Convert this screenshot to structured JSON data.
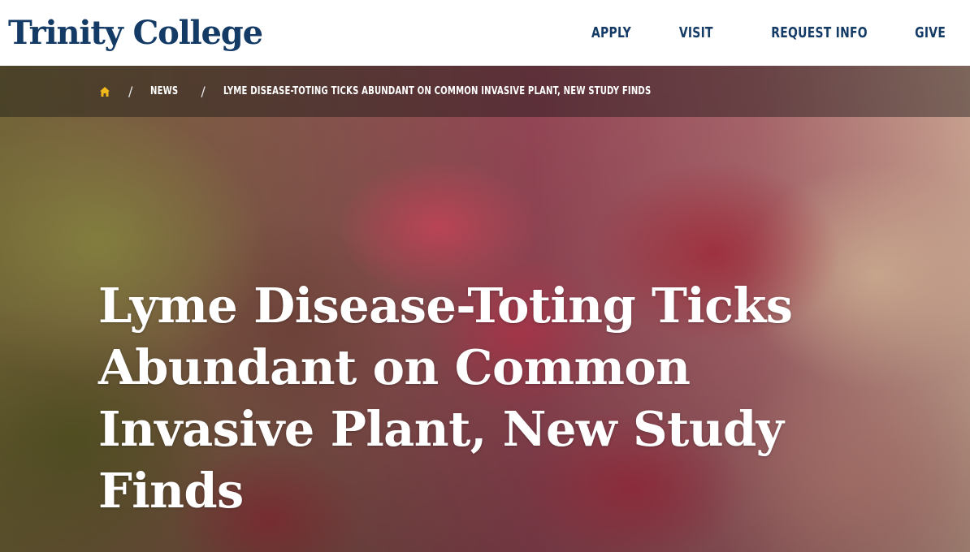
{
  "header": {
    "logo_text": "Trinity College",
    "nav": [
      {
        "label": "APPLY"
      },
      {
        "label": "VISIT"
      },
      {
        "label": "REQUEST INFO"
      },
      {
        "label": "GIVE"
      }
    ]
  },
  "breadcrumb": {
    "home_icon": "home-icon",
    "home_icon_color": "#f2b91c",
    "separator": "/",
    "items": [
      {
        "label": "NEWS"
      },
      {
        "label": "LYME DISEASE-TOTING TICKS ABUNDANT ON COMMON INVASIVE PLANT, NEW STUDY FINDS"
      }
    ]
  },
  "hero": {
    "title": "Lyme Disease-Toting Ticks Abundant on Common Invasive Plant, New Study Finds"
  },
  "colors": {
    "brand": "#143a66",
    "accent": "#f2b91c"
  }
}
